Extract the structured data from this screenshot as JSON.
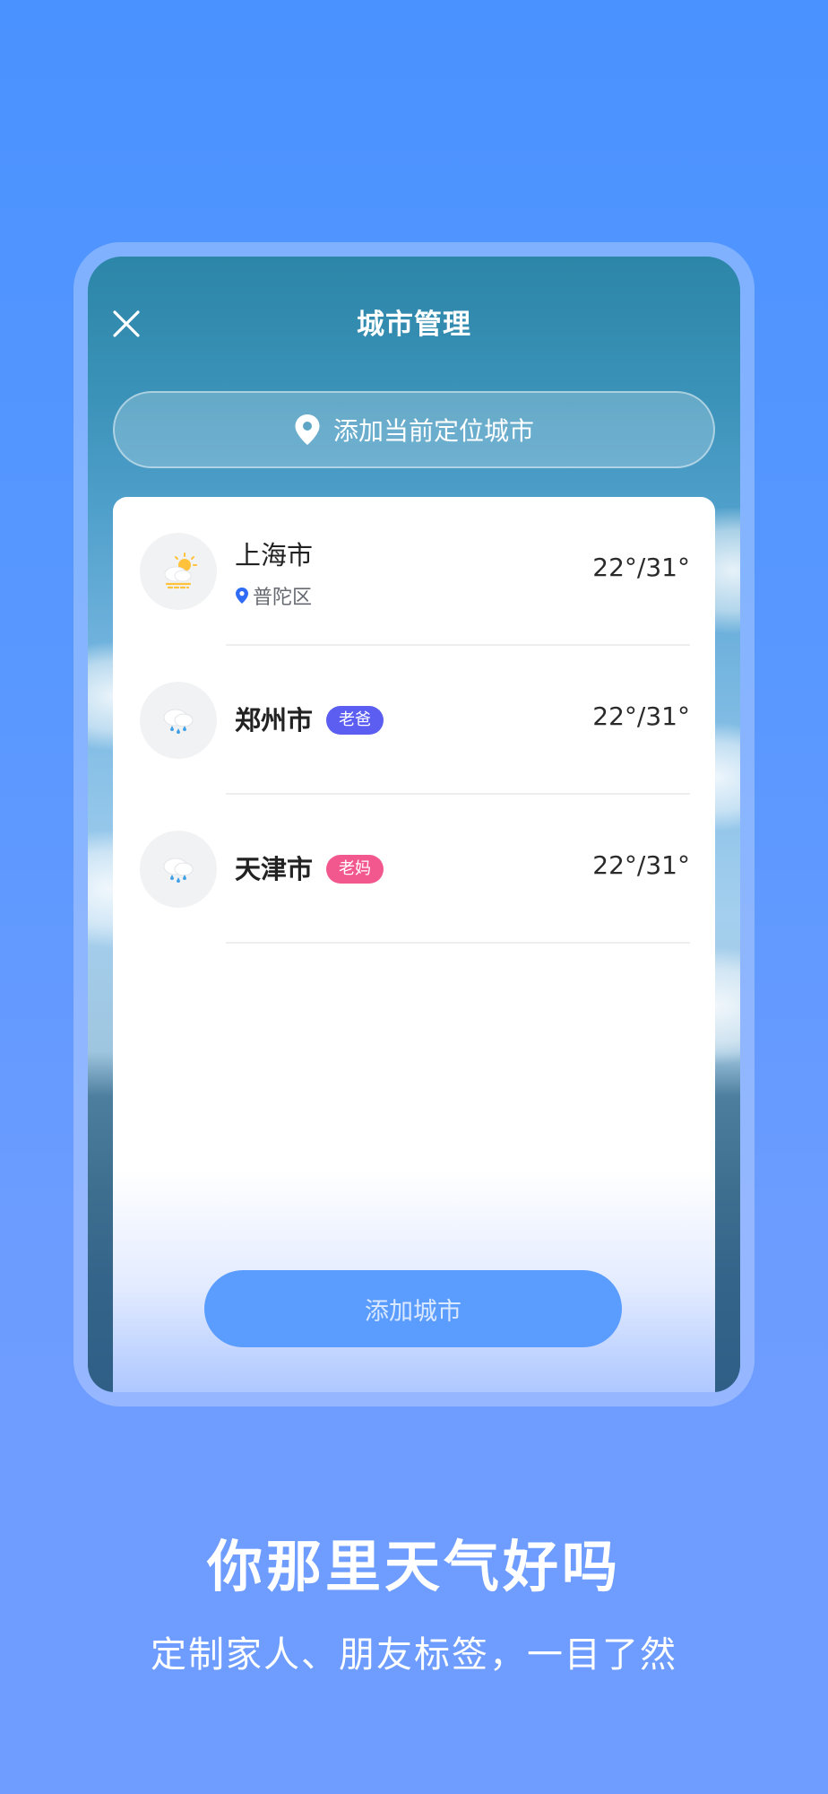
{
  "screen": {
    "title": "城市管理",
    "locate_button_label": "添加当前定位城市",
    "add_city_button_label": "添加城市"
  },
  "cities": [
    {
      "name": "上海市",
      "district": "普陀区",
      "tag": "",
      "temp": "22°/31°",
      "weather_icon": "sun-cloud-icon"
    },
    {
      "name": "郑州市",
      "district": "",
      "tag": "老爸",
      "tag_color": "#5b5ef0",
      "temp": "22°/31°",
      "weather_icon": "rain-cloud-icon"
    },
    {
      "name": "天津市",
      "district": "",
      "tag": "老妈",
      "tag_color": "#f2588e",
      "temp": "22°/31°",
      "weather_icon": "rain-cloud-icon"
    }
  ],
  "promo": {
    "headline": "你那里天气好吗",
    "subline": "定制家人、朋友标签，一目了然"
  },
  "colors": {
    "page_bg": "#5a98ff",
    "accent_blue": "#5b9cff",
    "tag_dad": "#5b5ef0",
    "tag_mom": "#f2588e"
  }
}
